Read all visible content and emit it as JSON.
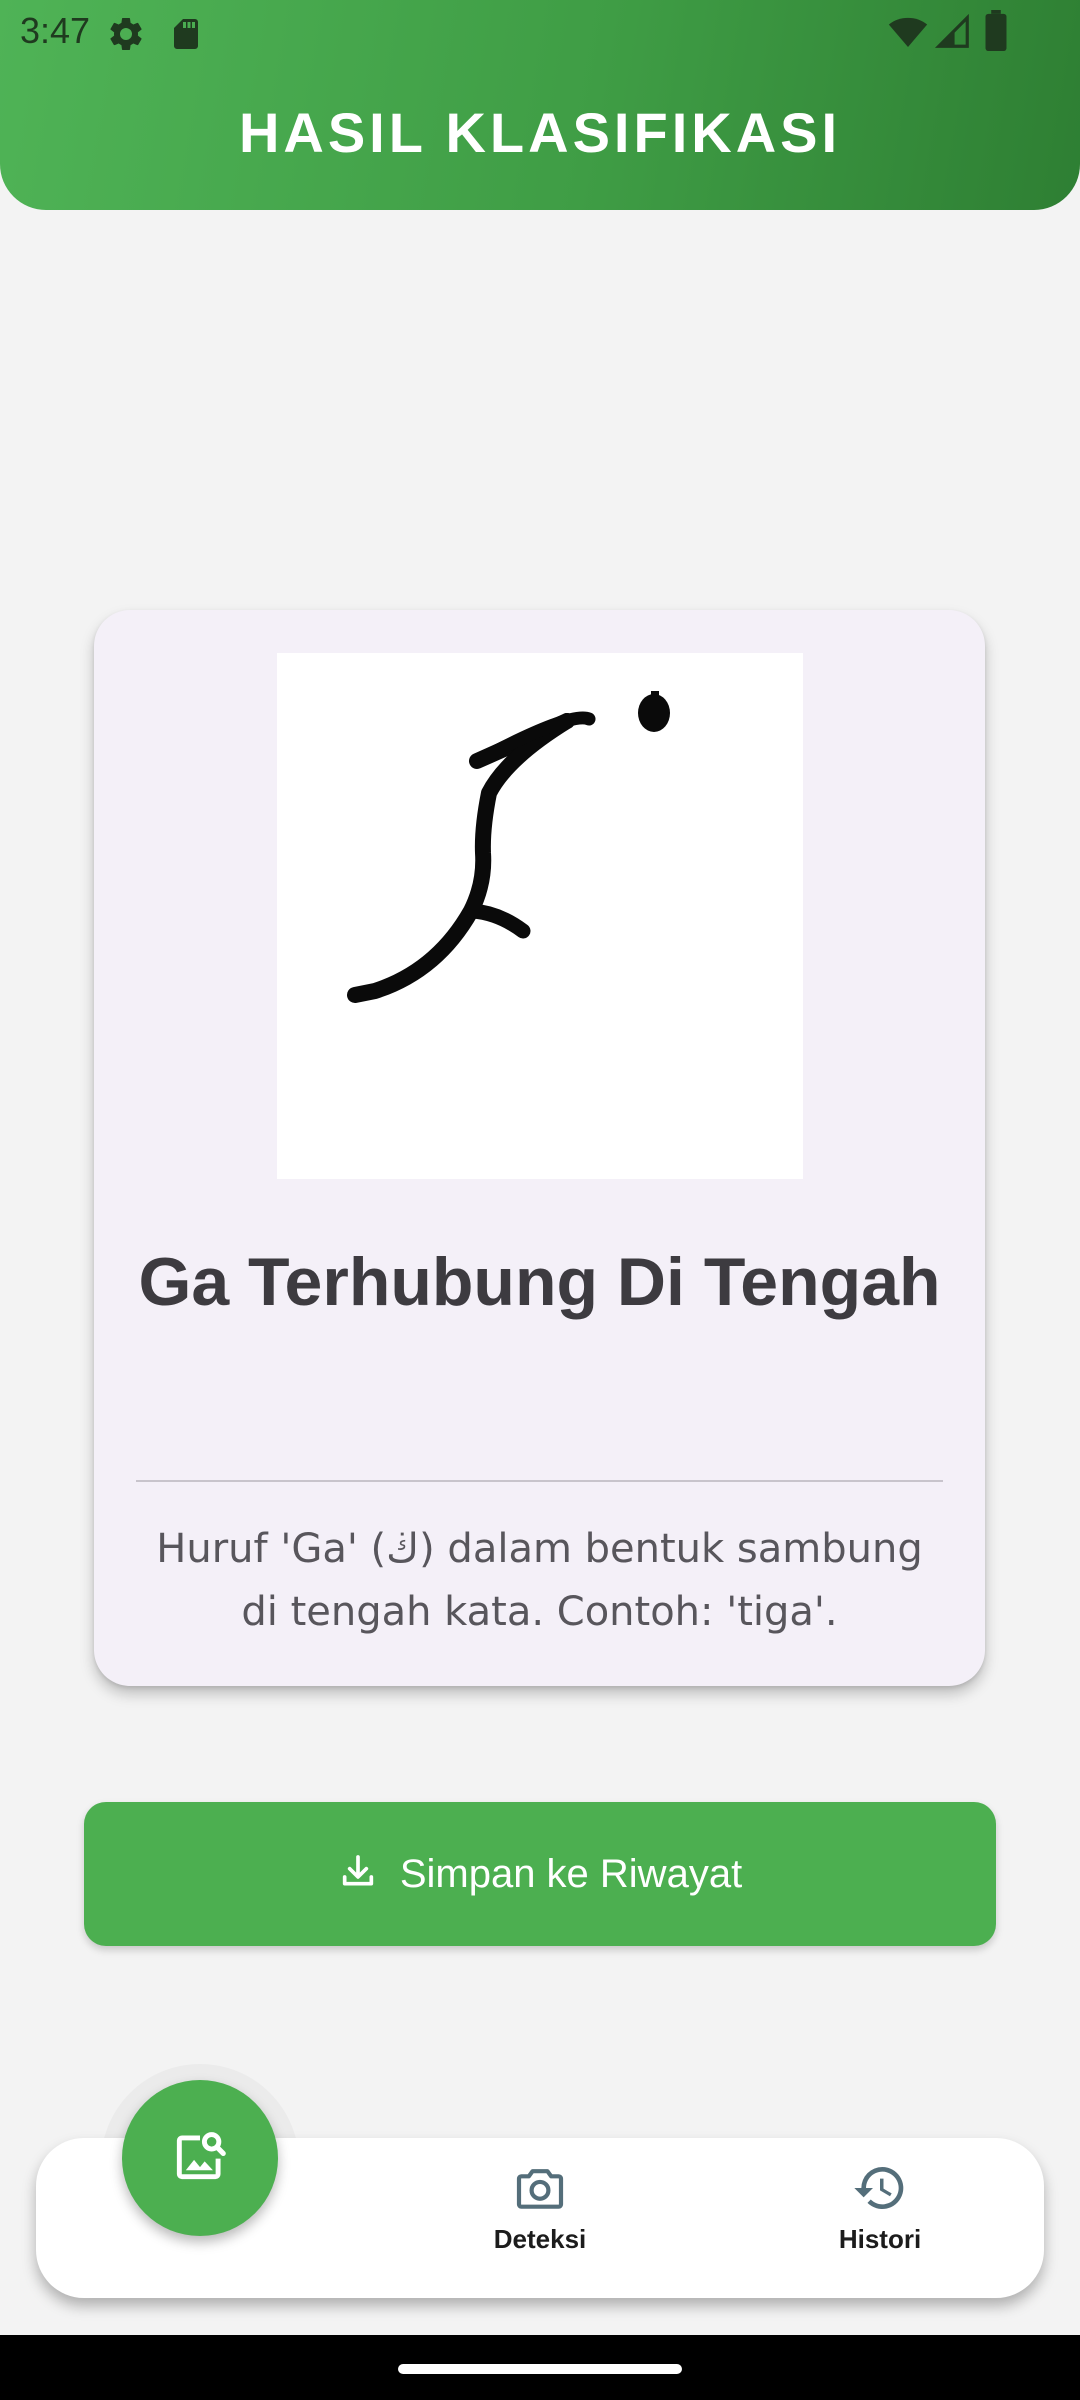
{
  "status_bar": {
    "time": "3:47"
  },
  "header": {
    "title": "HASIL KLASIFIKASI"
  },
  "result_card": {
    "title": "Ga Terhubung Di Tengah",
    "description": "Huruf 'Ga' (ڬ) dalam bentuk sambung di tengah kata. Contoh: 'tiga'."
  },
  "save_button": {
    "label": "Simpan ke Riwayat",
    "icon": "download-icon"
  },
  "bottom_nav": {
    "fab_icon": "image-search-icon",
    "items": [
      {
        "label": "Deteksi",
        "icon": "camera-icon"
      },
      {
        "label": "Histori",
        "icon": "history-icon"
      }
    ]
  },
  "colors": {
    "primary_green": "#4caf50",
    "header_gradient_start": "#4fb356",
    "header_gradient_end": "#2e7f33",
    "card_background": "#f4f0f8",
    "nav_icon": "#546e7a"
  }
}
